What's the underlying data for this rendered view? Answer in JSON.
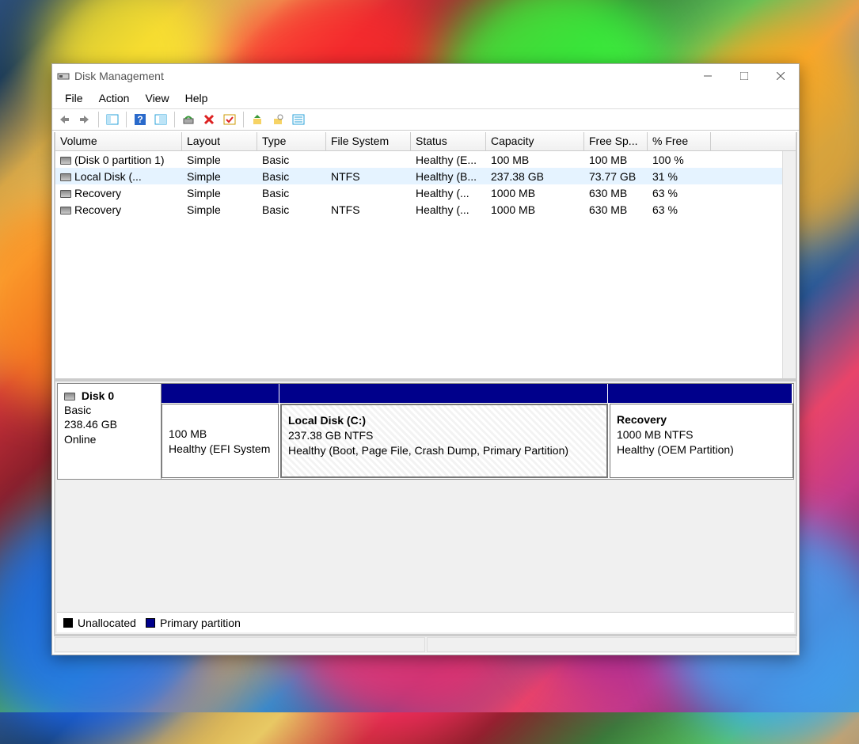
{
  "window": {
    "title": "Disk Management"
  },
  "menu": {
    "file": "File",
    "action": "Action",
    "view": "View",
    "help": "Help"
  },
  "toolbar_icons": {
    "back": "back-arrow-icon",
    "forward": "forward-arrow-icon",
    "show_hide": "show-hide-tree-icon",
    "help": "help-icon",
    "props": "properties-icon",
    "refresh": "refresh-icon",
    "delete": "delete-icon",
    "mark": "mark-icon",
    "up1": "action-icon-1",
    "up2": "action-icon-2",
    "list": "list-icon"
  },
  "columns": {
    "volume": "Volume",
    "layout": "Layout",
    "type": "Type",
    "file_system": "File System",
    "status": "Status",
    "capacity": "Capacity",
    "free": "Free Sp...",
    "pct": "% Free"
  },
  "volumes": [
    {
      "name": "(Disk 0 partition 1)",
      "layout": "Simple",
      "type": "Basic",
      "fs": "",
      "status": "Healthy (E...",
      "capacity": "100 MB",
      "free": "100 MB",
      "pct": "100 %",
      "selected": false
    },
    {
      "name": "Local Disk (...",
      "layout": "Simple",
      "type": "Basic",
      "fs": "NTFS",
      "status": "Healthy (B...",
      "capacity": "237.38 GB",
      "free": "73.77 GB",
      "pct": "31 %",
      "selected": true
    },
    {
      "name": "Recovery",
      "layout": "Simple",
      "type": "Basic",
      "fs": "",
      "status": "Healthy (...",
      "capacity": "1000 MB",
      "free": "630 MB",
      "pct": "63 %",
      "selected": false
    },
    {
      "name": "Recovery",
      "layout": "Simple",
      "type": "Basic",
      "fs": "NTFS",
      "status": "Healthy (...",
      "capacity": "1000 MB",
      "free": "630 MB",
      "pct": "63 %",
      "selected": false
    }
  ],
  "disk": {
    "label": "Disk 0",
    "type": "Basic",
    "size": "238.46 GB",
    "state": "Online",
    "partitions": [
      {
        "name": "",
        "size_fs": "100 MB",
        "status": "Healthy (EFI System",
        "selected": false
      },
      {
        "name": "Local Disk  (C:)",
        "size_fs": "237.38 GB NTFS",
        "status": "Healthy (Boot, Page File, Crash Dump, Primary Partition)",
        "selected": true
      },
      {
        "name": "Recovery",
        "size_fs": "1000 MB NTFS",
        "status": "Healthy (OEM Partition)",
        "selected": false
      }
    ]
  },
  "legend": {
    "unallocated": "Unallocated",
    "primary": "Primary partition"
  }
}
